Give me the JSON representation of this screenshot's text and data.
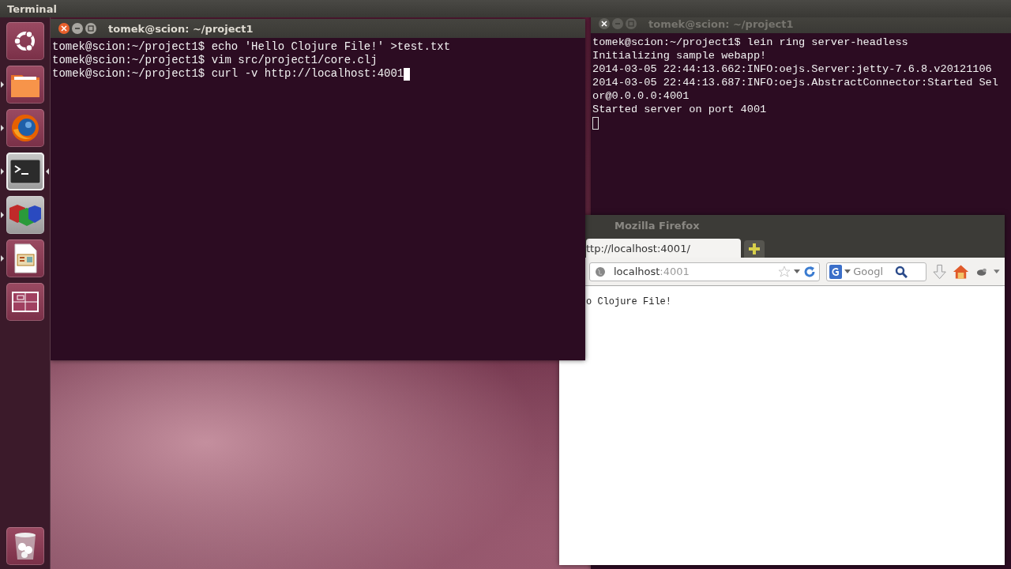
{
  "top_panel": {
    "app_title": "Terminal"
  },
  "launcher": {
    "items": [
      {
        "kind": "ubuntu",
        "running": false,
        "focused": false
      },
      {
        "kind": "files",
        "running": true,
        "focused": false
      },
      {
        "kind": "firefox",
        "running": true,
        "focused": false
      },
      {
        "kind": "terminal",
        "running": true,
        "focused": true
      },
      {
        "kind": "cubes",
        "running": true,
        "focused": false
      },
      {
        "kind": "impress",
        "running": true,
        "focused": false
      },
      {
        "kind": "workspaces",
        "running": false,
        "focused": false
      }
    ],
    "trash": {
      "kind": "trash"
    }
  },
  "terminals": [
    {
      "title": "tomek@scion: ~/project1",
      "active": true,
      "cursor_on_new_line": false,
      "lines": [
        "tomek@scion:~/project1$ echo 'Hello Clojure File!' >test.txt",
        "tomek@scion:~/project1$ vim src/project1/core.clj",
        "tomek@scion:~/project1$ curl -v http://localhost:4001"
      ]
    },
    {
      "title": "tomek@scion: ~/project1",
      "active": false,
      "cursor_on_new_line": true,
      "lines": [
        "tomek@scion:~/project1$ lein ring server-headless",
        "Initializing sample webapp!",
        "2014-03-05 22:44:13.662:INFO:oejs.Server:jetty-7.6.8.v20121106",
        "2014-03-05 22:44:13.687:INFO:oejs.AbstractConnector:Started Sel",
        "or@0.0.0.0:4001",
        "Started server on port 4001"
      ]
    }
  ],
  "firefox": {
    "title": "Mozilla Firefox",
    "active": false,
    "tabs": [
      {
        "label": "ttp://localhost:4001/",
        "selected": true
      }
    ],
    "url_host": "localhost",
    "url_port": ":4001",
    "search_placeholder": "Googl",
    "page_text": "o Clojure File!"
  }
}
